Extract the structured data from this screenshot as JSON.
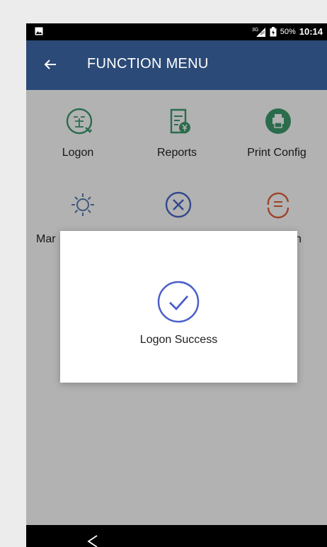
{
  "status_bar": {
    "network": "3G",
    "battery_percent": "50%",
    "time": "10:14",
    "icons": [
      "image-notification-icon",
      "signal-icon",
      "battery-icon"
    ]
  },
  "app_bar": {
    "title": "FUNCTION MENU",
    "back_icon": "arrow-left-icon"
  },
  "menu": {
    "items": [
      {
        "label": "Logon",
        "icon": "sign-in-icon",
        "color": "#3e9b6f"
      },
      {
        "label": "Reports",
        "icon": "report-icon",
        "color": "#3e9b6f"
      },
      {
        "label": "Print Config",
        "icon": "printer-icon",
        "color": "#3e9b6f"
      },
      {
        "label": "Mar",
        "icon": "gear-icon",
        "color": "#5a7fb0"
      },
      {
        "label": "",
        "icon": "cancel-circle-icon",
        "color": "#4a67c9"
      },
      {
        "label": "n",
        "icon": "refresh-icon",
        "color": "#e0623a"
      }
    ]
  },
  "dialog": {
    "message": "Logon Success",
    "icon": "check-circle-icon",
    "accent": "#4a5fc9"
  },
  "nav_bar": {
    "icons": [
      "back-triangle-icon"
    ]
  },
  "colors": {
    "app_bar": "#2c4a77",
    "status_bar": "#000000"
  }
}
